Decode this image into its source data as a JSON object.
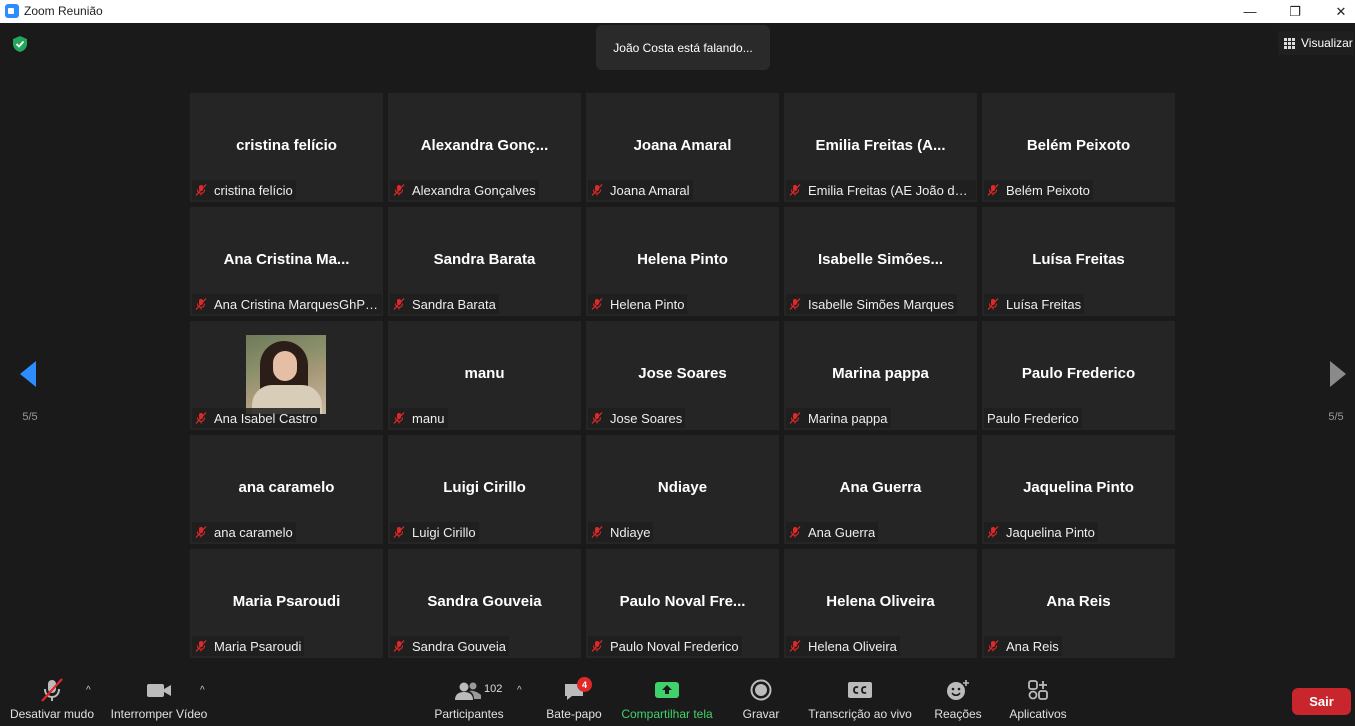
{
  "window": {
    "title": "Zoom Reunião",
    "minimize": "—",
    "restore": "❐",
    "close": "✕"
  },
  "header": {
    "speaking": "João Costa está falando...",
    "view_label": "Visualizar"
  },
  "pager": {
    "left_label": "5/5",
    "right_label": "5/5"
  },
  "tiles": [
    {
      "display": "cristina felício",
      "label": "cristina felício",
      "muted": true
    },
    {
      "display": "Alexandra  Gonç...",
      "label": "Alexandra Gonçalves",
      "muted": true
    },
    {
      "display": "Joana Amaral",
      "label": "Joana Amaral",
      "muted": true
    },
    {
      "display": "Emilia Freitas  (A...",
      "label": "Emilia Freitas (AE João da ...",
      "muted": true
    },
    {
      "display": "Belém Peixoto",
      "label": "Belém Peixoto",
      "muted": true
    },
    {
      "display": "Ana  Cristina  Ma...",
      "label": "Ana Cristina MarquesGhP9...",
      "muted": true
    },
    {
      "display": "Sandra Barata",
      "label": "Sandra Barata",
      "muted": true
    },
    {
      "display": "Helena  Pinto",
      "label": "Helena  Pinto",
      "muted": true
    },
    {
      "display": "Isabelle  Simões...",
      "label": "Isabelle Simões Marques",
      "muted": true
    },
    {
      "display": "Luísa Freitas",
      "label": "Luísa Freitas",
      "muted": true
    },
    {
      "display": "",
      "label": "Ana Isabel Castro",
      "muted": true,
      "photo": true
    },
    {
      "display": "manu",
      "label": "manu",
      "muted": true
    },
    {
      "display": "Jose Soares",
      "label": "Jose Soares",
      "muted": true
    },
    {
      "display": "Marina pappa",
      "label": "Marina pappa",
      "muted": true
    },
    {
      "display": "Paulo Frederico",
      "label": "Paulo Frederico",
      "muted": false
    },
    {
      "display": "ana caramelo",
      "label": "ana caramelo",
      "muted": true
    },
    {
      "display": "Luigi Cirillo",
      "label": "Luigi Cirillo",
      "muted": true
    },
    {
      "display": "Ndiaye",
      "label": "Ndiaye",
      "muted": true
    },
    {
      "display": "Ana Guerra",
      "label": "Ana Guerra",
      "muted": true
    },
    {
      "display": "Jaquelina Pinto",
      "label": "Jaquelina Pinto",
      "muted": true
    },
    {
      "display": "Maria Psaroudi",
      "label": "Maria Psaroudi",
      "muted": true
    },
    {
      "display": "Sandra Gouveia",
      "label": "Sandra Gouveia",
      "muted": true
    },
    {
      "display": "Paulo  Noval  Fre...",
      "label": "Paulo Noval Frederico",
      "muted": true
    },
    {
      "display": "Helena Oliveira",
      "label": "Helena Oliveira",
      "muted": true
    },
    {
      "display": "Ana Reis",
      "label": "Ana Reis",
      "muted": true
    }
  ],
  "toolbar": {
    "unmute": "Desativar mudo",
    "stop_video": "Interromper Vídeo",
    "participants": "Participantes",
    "participants_count": "102",
    "chat": "Bate-papo",
    "chat_badge": "4",
    "share": "Compartilhar tela",
    "record": "Gravar",
    "transcription": "Transcrição ao vivo",
    "reactions": "Reações",
    "apps": "Aplicativos",
    "leave": "Sair",
    "caret": "^"
  },
  "colors": {
    "background": "#1a1a1a",
    "tile": "#252525",
    "share_green": "#3fd26b",
    "leave_red": "#c8252c",
    "badge_red": "#e02828",
    "accent_blue": "#2d8cff",
    "shield_green": "#23a55a"
  },
  "icons": {
    "muted": "mic-off-icon",
    "video": "camera-icon",
    "participants": "people-icon",
    "chat": "chat-bubble-icon",
    "share": "share-screen-icon",
    "record": "record-icon",
    "transcription": "cc-icon",
    "reactions": "emoji-icon",
    "apps": "apps-icon",
    "shield": "shield-check-icon",
    "grid": "grid-view-icon"
  }
}
